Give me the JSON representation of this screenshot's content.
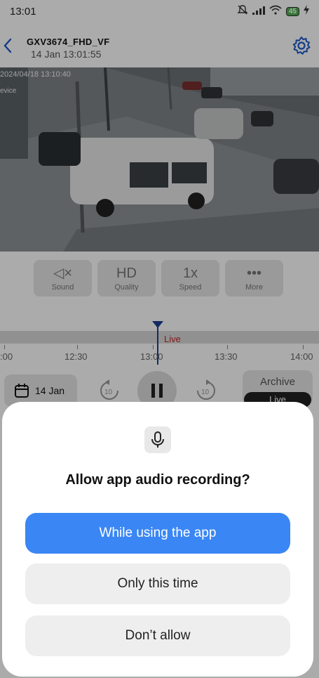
{
  "status_bar": {
    "time": "13:01",
    "battery": "45"
  },
  "header": {
    "camera_name": "GXV3674_FHD_VF",
    "timestamp": "14 Jan 13:01:55"
  },
  "video": {
    "osd_timestamp": "2024/04/18 13:10:40",
    "osd_device": "evice"
  },
  "controls": [
    {
      "glyph": "◁×",
      "label": "Sound"
    },
    {
      "glyph": "HD",
      "label": "Quality"
    },
    {
      "glyph": "1x",
      "label": "Speed"
    },
    {
      "glyph": "•••",
      "label": "More"
    }
  ],
  "timeline": {
    "live_label": "Live",
    "labels": [
      ":00",
      "12:30",
      "13:00",
      "13:30",
      "14:00"
    ]
  },
  "bottom": {
    "date": "14 Jan",
    "archive": "Archive",
    "live": "Live"
  },
  "dialog": {
    "title": "Allow app audio recording?",
    "allow_while_using": "While using the app",
    "only_this_time": "Only this time",
    "deny": "Don’t allow"
  },
  "colors": {
    "primary": "#3a86f4",
    "accent_header": "#1c5cc9",
    "live_red": "#c62828"
  }
}
